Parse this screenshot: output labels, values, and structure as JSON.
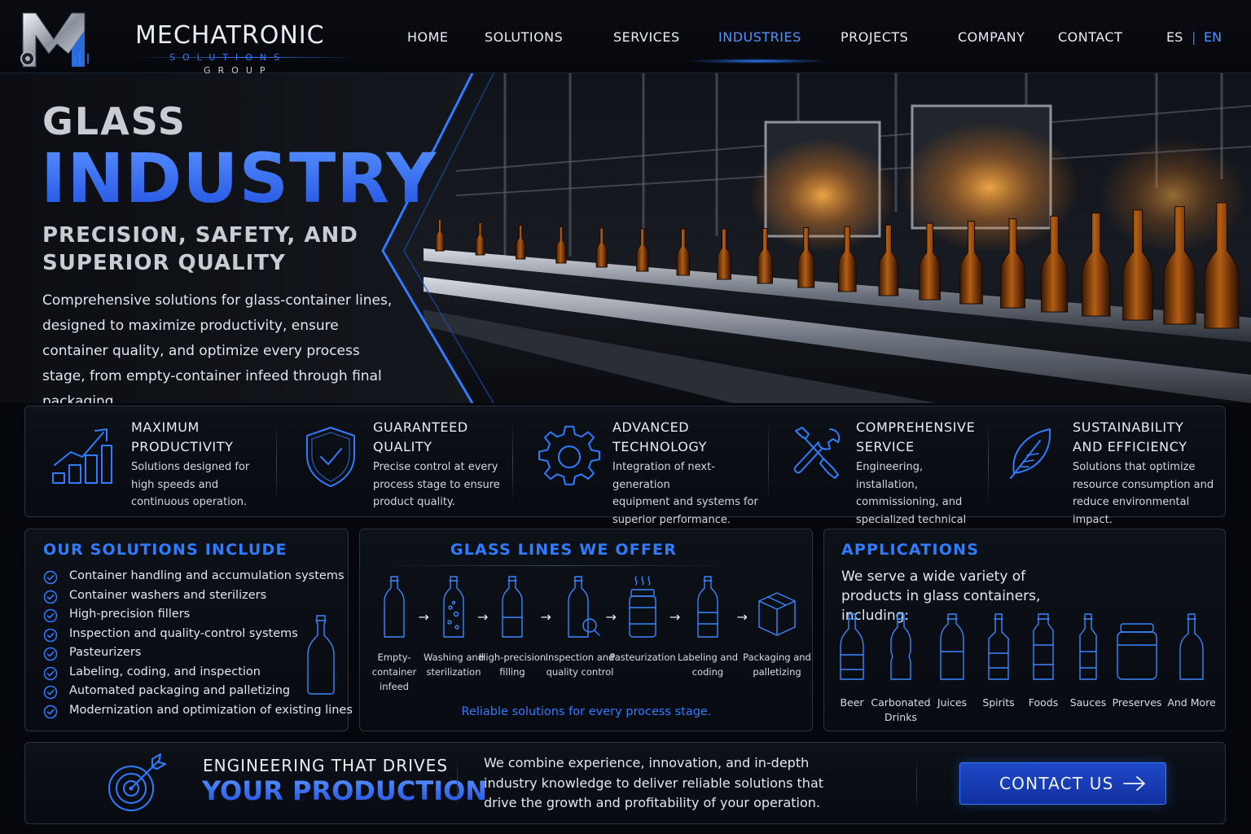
{
  "header": {
    "brand_name": "MECHATRONIC",
    "brand_sub": "SOLUTIONS",
    "brand_sub2": "GROUP",
    "nav": [
      {
        "label": "HOME",
        "active": false
      },
      {
        "label": "SOLUTIONS",
        "active": false
      },
      {
        "label": "SERVICES",
        "active": false
      },
      {
        "label": "INDUSTRIES",
        "active": true
      },
      {
        "label": "PROJECTS",
        "active": false
      },
      {
        "label": "COMPANY",
        "active": false
      },
      {
        "label": "CONTACT",
        "active": false
      }
    ],
    "lang_es": "ES",
    "lang_sep": "|",
    "lang_en": "EN",
    "active_lang": "EN"
  },
  "hero": {
    "title_line1": "GLASS",
    "title_line2": "INDUSTRY",
    "subtitle": "PRECISION, SAFETY, AND SUPERIOR QUALITY",
    "description": "Comprehensive solutions for glass-container lines, designed to maximize productivity, ensure container quality, and optimize every process stage, from empty-container infeed through final packaging."
  },
  "features": [
    {
      "icon": "bar-chart-growth-icon",
      "title": "MAXIMUM\nPRODUCTIVITY",
      "desc": "Solutions designed for\nhigh speeds and\ncontinuous operation."
    },
    {
      "icon": "shield-check-icon",
      "title": "GUARANTEED\nQUALITY",
      "desc": "Precise control at every\nprocess stage to ensure\nproduct quality."
    },
    {
      "icon": "gear-icon",
      "title": "ADVANCED\nTECHNOLOGY",
      "desc": "Integration of next-generation\nequipment and systems for\nsuperior performance."
    },
    {
      "icon": "wrench-screwdriver-icon",
      "title": "COMPREHENSIVE\nSERVICE",
      "desc": "Engineering, installation,\ncommissioning, and\nspecialized technical support."
    },
    {
      "icon": "leaf-icon",
      "title": "SUSTAINABILITY\nAND EFFICIENCY",
      "desc": "Solutions that optimize\nresource consumption and\nreduce environmental impact."
    }
  ],
  "solutions": {
    "title": "OUR SOLUTIONS INCLUDE",
    "items": [
      "Container handling and accumulation systems",
      "Container washers and sterilizers",
      "High-precision fillers",
      "Inspection and quality-control systems",
      "Pasteurizers",
      "Labeling, coding, and inspection",
      "Automated packaging and palletizing",
      "Modernization and optimization of existing lines"
    ]
  },
  "lines": {
    "title": "GLASS LINES WE OFFER",
    "steps": [
      {
        "icon": "empty-bottle-icon",
        "label": "Empty-container\ninfeed"
      },
      {
        "icon": "bubbles-bottle-icon",
        "label": "Washing and\nsterilization"
      },
      {
        "icon": "filling-bottle-icon",
        "label": "High-precision\nfilling"
      },
      {
        "icon": "magnifier-bottle-icon",
        "label": "Inspection and\nquality control"
      },
      {
        "icon": "steaming-jar-icon",
        "label": "Pasteurization"
      },
      {
        "icon": "labeled-bottle-icon",
        "label": "Labeling and\ncoding"
      },
      {
        "icon": "box-icon",
        "label": "Packaging and\npalletizing"
      }
    ],
    "arrow": "→",
    "footer": "Reliable solutions for every process stage."
  },
  "applications": {
    "title": "APPLICATIONS",
    "intro": "We serve a wide variety of products in glass containers, including:",
    "items": [
      {
        "icon": "beer-bottle-icon",
        "label": "Beer"
      },
      {
        "icon": "soda-bottle-icon",
        "label": "Carbonated\nDrinks"
      },
      {
        "icon": "juice-bottle-icon",
        "label": "Juices"
      },
      {
        "icon": "spirits-bottle-icon",
        "label": "Spirits"
      },
      {
        "icon": "food-bottle-icon",
        "label": "Foods"
      },
      {
        "icon": "sauce-bottle-icon",
        "label": "Sauces"
      },
      {
        "icon": "preserve-jar-icon",
        "label": "Preserves"
      },
      {
        "icon": "wine-bottle-icon",
        "label": "And More"
      }
    ]
  },
  "cta": {
    "line1": "ENGINEERING THAT DRIVES",
    "line2": "YOUR PRODUCTION",
    "description": "We combine experience, innovation, and in-depth industry knowledge to deliver reliable solutions that drive the growth and profitability of your operation.",
    "button_label": "CONTACT US"
  },
  "colors": {
    "accent": "#2f7cff",
    "background": "#05070c",
    "amber": "#c9741a"
  }
}
